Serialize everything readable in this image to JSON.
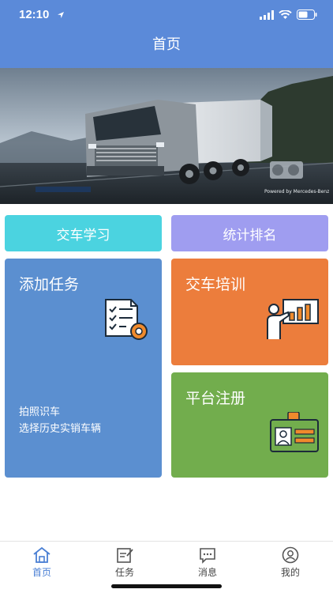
{
  "status_bar": {
    "time": "12:10",
    "location_icon": "location-arrow-icon",
    "signal_icon": "signal-icon",
    "wifi_icon": "wifi-icon",
    "battery_icon": "battery-icon"
  },
  "header": {
    "title": "首页",
    "background": "#5b8ad9"
  },
  "banner": {
    "brand_text": "Powered by Mercedes-Benz",
    "dots_count": 9,
    "active_dot": 2
  },
  "quick_actions": [
    {
      "label": "交车学习",
      "color": "#4bd3e0"
    },
    {
      "label": "统计排名",
      "color": "#9f9df0"
    }
  ],
  "cards": {
    "task": {
      "title": "添加任务",
      "lines": [
        "拍照识车",
        "选择历史实销车辆"
      ],
      "color": "#5b8fd0",
      "icon": "checklist-gear-icon"
    },
    "training": {
      "title": "交车培训",
      "color": "#ec7d3c",
      "icon": "presenter-board-icon"
    },
    "register": {
      "title": "平台注册",
      "color": "#72ad4d",
      "icon": "id-card-icon"
    }
  },
  "tabbar": {
    "items": [
      {
        "label": "首页",
        "icon": "home-icon",
        "active": true
      },
      {
        "label": "任务",
        "icon": "task-edit-icon",
        "active": false
      },
      {
        "label": "消息",
        "icon": "message-icon",
        "active": false
      },
      {
        "label": "我的",
        "icon": "user-icon",
        "active": false
      }
    ]
  }
}
